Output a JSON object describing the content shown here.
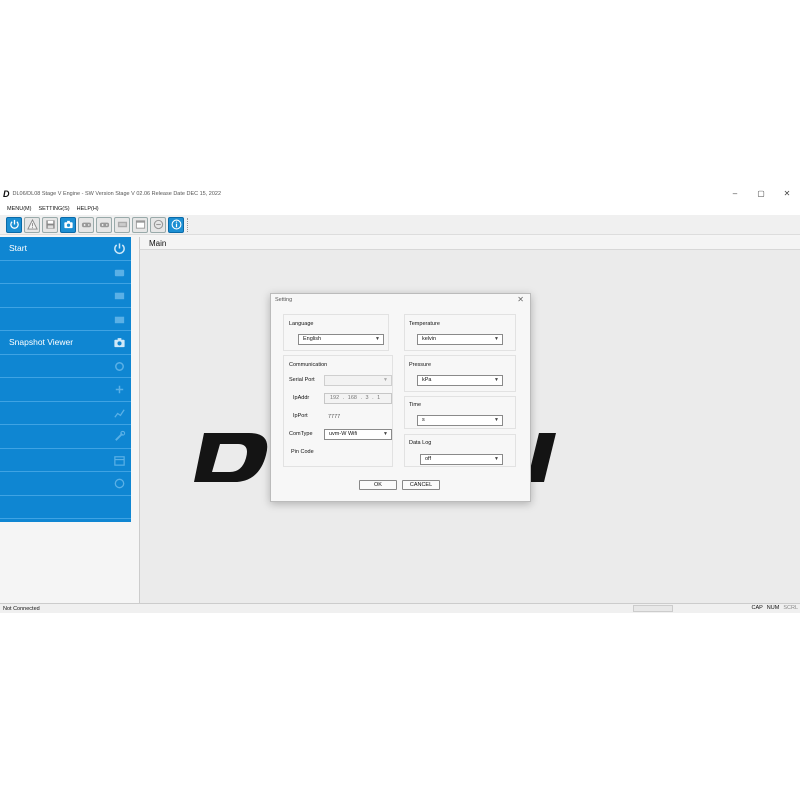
{
  "window": {
    "logo": "D",
    "title": "DL06/DL08 Stage V Engine - SW Version Stage V 02.06 Release Date DEC 15, 2022",
    "minimize": "–",
    "maximize": "▢",
    "close": "✕"
  },
  "menu": {
    "items": [
      "MENU(M)",
      "SETTING(S)",
      "HELP(H)"
    ]
  },
  "toolbar": {
    "buttons": [
      {
        "icon": "power-icon",
        "active": true
      },
      {
        "icon": "warning-icon",
        "active": false
      },
      {
        "icon": "save-icon",
        "active": false
      },
      {
        "icon": "camera-icon",
        "active": true
      },
      {
        "icon": "gamepad-icon",
        "active": false
      },
      {
        "icon": "gamepad-icon",
        "active": false
      },
      {
        "icon": "ecu-icon",
        "active": false
      },
      {
        "icon": "window-icon",
        "active": false
      },
      {
        "icon": "circle-icon",
        "active": false
      },
      {
        "icon": "info-icon",
        "active": true
      }
    ]
  },
  "sidebar": {
    "items": [
      {
        "label": "Start",
        "icon": "power-icon"
      },
      {
        "label": "",
        "icon": "engine-icon"
      },
      {
        "label": "",
        "icon": "ecu-icon"
      },
      {
        "label": "",
        "icon": "ecu-icon"
      },
      {
        "label": "Snapshot Viewer",
        "icon": "camera-icon"
      },
      {
        "label": "",
        "icon": "gear-icon"
      },
      {
        "label": "",
        "icon": "gamepad-icon"
      },
      {
        "label": "",
        "icon": "chart-icon"
      },
      {
        "label": "",
        "icon": "wrench-icon"
      },
      {
        "label": "",
        "icon": "calendar-icon"
      },
      {
        "label": "",
        "icon": "refresh-icon"
      },
      {
        "label": "",
        "icon": "none"
      }
    ]
  },
  "main": {
    "title": "Main"
  },
  "status": {
    "left": "Not Connected",
    "indicators": [
      {
        "label": "CAP",
        "on": true
      },
      {
        "label": "NUM",
        "on": true
      },
      {
        "label": "SCRL",
        "on": false
      }
    ]
  },
  "dialog": {
    "title": "Setting",
    "close": "✕",
    "language": {
      "label": "Language",
      "value": "English"
    },
    "communication": {
      "label": "Communication",
      "serial_port_label": "Serial Port",
      "serial_port_value": "",
      "ipaddr_label": "IpAddr",
      "ipaddr_value": "192 . 168 . 3 . 1",
      "ipport_label": "IpPort",
      "ipport_value": "7777",
      "comtype_label": "ComType",
      "comtype_value": "uvm-W Wifi",
      "pincode_label": "Pin Code"
    },
    "temperature": {
      "label": "Temperature",
      "value": "kelvin"
    },
    "pressure": {
      "label": "Pressure",
      "value": "kPa"
    },
    "time": {
      "label": "Time",
      "value": "s"
    },
    "datalog": {
      "label": "Data Log",
      "value": "off"
    },
    "ok": "OK",
    "cancel": "CANCEL"
  },
  "colors": {
    "sidebar_blue": "#0f86d2",
    "toolbar_active": "#1c8fd3"
  }
}
